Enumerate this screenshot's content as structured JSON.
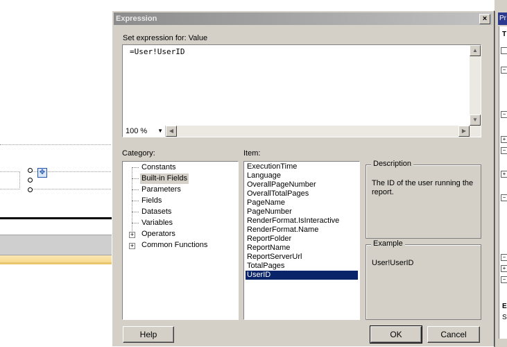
{
  "dialog": {
    "title": "Expression",
    "close_glyph": "×",
    "set_expression_label": "Set expression for: Value",
    "expression": "=User!UserID",
    "zoom": "100 %",
    "category_label": "Category:",
    "item_label": "Item:",
    "categories": [
      {
        "label": "Constants",
        "expandable": false,
        "selected": false
      },
      {
        "label": "Built-in Fields",
        "expandable": false,
        "selected": true
      },
      {
        "label": "Parameters",
        "expandable": false,
        "selected": false
      },
      {
        "label": "Fields",
        "expandable": false,
        "selected": false
      },
      {
        "label": "Datasets",
        "expandable": false,
        "selected": false
      },
      {
        "label": "Variables",
        "expandable": false,
        "selected": false
      },
      {
        "label": "Operators",
        "expandable": true,
        "selected": false
      },
      {
        "label": "Common Functions",
        "expandable": true,
        "selected": false
      }
    ],
    "items": [
      "ExecutionTime",
      "Language",
      "OverallPageNumber",
      "OverallTotalPages",
      "PageName",
      "PageNumber",
      "RenderFormat.IsInteractive",
      "RenderFormat.Name",
      "ReportFolder",
      "ReportName",
      "ReportServerUrl",
      "TotalPages",
      "UserID"
    ],
    "selected_item": "UserID",
    "description_title": "Description",
    "description_text": "The ID of the user running the report.",
    "example_title": "Example",
    "example_text": "User!UserID",
    "help_button": "Help",
    "ok_button": "OK",
    "cancel_button": "Cancel"
  },
  "properties_panel": {
    "title": "Pr",
    "letters": [
      "T",
      "E",
      "S"
    ]
  },
  "colors": {
    "selection": "#0a246a",
    "dialog_bg": "#d4d0c8",
    "inactive_title": "#8c8c8c"
  }
}
